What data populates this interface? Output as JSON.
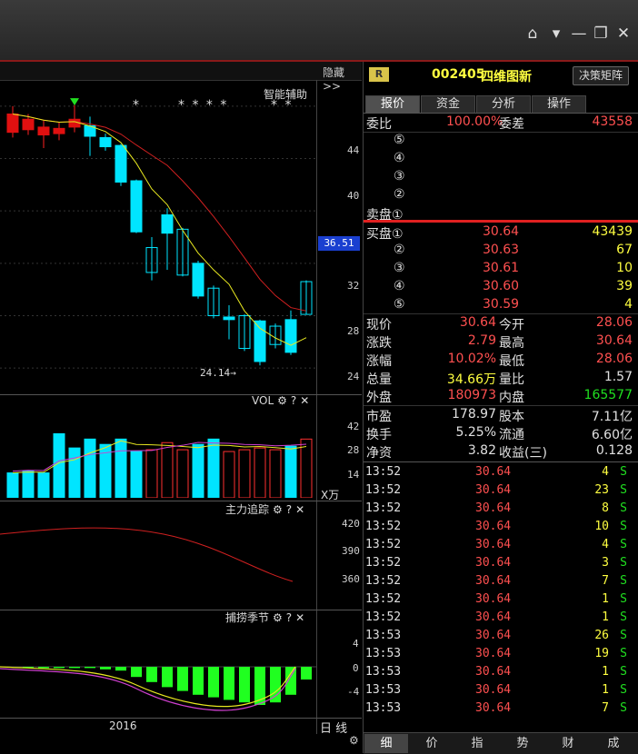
{
  "left": {
    "hide_label": "隐藏>>",
    "assist_label": "智能辅助",
    "stars_a": "*",
    "stars_b": "* * * *",
    "stars_c": "* *",
    "price_axis": [
      "44",
      "40",
      "32",
      "28",
      "24"
    ],
    "current_price_tag": "36.51",
    "low_marker": "24.14",
    "vol_title": "VOL",
    "vol_axis": [
      "42",
      "28",
      "14"
    ],
    "vol_unit": "X万",
    "main_title": "主力追踪",
    "main_axis": [
      "420",
      "390",
      "360"
    ],
    "season_title": "捕捞季节",
    "season_axis": [
      "4",
      "0",
      "-4"
    ],
    "year_label": "2016",
    "period_button": "日 线"
  },
  "quote": {
    "badge": "R",
    "code": "002405",
    "name": "四维图新",
    "matrix_button": "决策矩阵",
    "tabs": [
      "报价",
      "资金",
      "分析",
      "操作"
    ],
    "weibi_label": "委比",
    "weibi_value": "100.00%",
    "weicha_label": "委差",
    "weicha_value": "43558",
    "sell_labels": [
      "⑤",
      "④",
      "③",
      "②",
      "卖盘①"
    ],
    "buy": [
      {
        "label": "买盘①",
        "price": "30.64",
        "vol": "43439"
      },
      {
        "label": "②",
        "price": "30.63",
        "vol": "67"
      },
      {
        "label": "③",
        "price": "30.61",
        "vol": "10"
      },
      {
        "label": "④",
        "price": "30.60",
        "vol": "39"
      },
      {
        "label": "⑤",
        "price": "30.59",
        "vol": "4"
      }
    ],
    "stats1": [
      {
        "l1": "现价",
        "v1": "30.64",
        "l2": "今开",
        "v2": "28.06"
      },
      {
        "l1": "涨跌",
        "v1": "2.79",
        "l2": "最高",
        "v2": "30.64"
      },
      {
        "l1": "涨幅",
        "v1": "10.02%",
        "l2": "最低",
        "v2": "28.06"
      },
      {
        "l1": "总量",
        "v1": "34.66万",
        "l2": "量比",
        "v2": "1.57"
      },
      {
        "l1": "外盘",
        "v1": "180973",
        "l2": "内盘",
        "v2": "165577"
      }
    ],
    "stats2": [
      {
        "l1": "市盈",
        "v1": "178.97",
        "l2": "股本",
        "v2": "7.11亿"
      },
      {
        "l1": "换手",
        "v1": "5.25%",
        "l2": "流通",
        "v2": "6.60亿"
      },
      {
        "l1": "净资",
        "v1": "3.82",
        "l2": "收益(三)",
        "v2": "0.128"
      }
    ],
    "ticks": [
      {
        "t": "13:52",
        "p": "30.64",
        "v": "4",
        "s": "S"
      },
      {
        "t": "13:52",
        "p": "30.64",
        "v": "23",
        "s": "S"
      },
      {
        "t": "13:52",
        "p": "30.64",
        "v": "8",
        "s": "S"
      },
      {
        "t": "13:52",
        "p": "30.64",
        "v": "10",
        "s": "S"
      },
      {
        "t": "13:52",
        "p": "30.64",
        "v": "4",
        "s": "S"
      },
      {
        "t": "13:52",
        "p": "30.64",
        "v": "3",
        "s": "S"
      },
      {
        "t": "13:52",
        "p": "30.64",
        "v": "7",
        "s": "S"
      },
      {
        "t": "13:52",
        "p": "30.64",
        "v": "1",
        "s": "S"
      },
      {
        "t": "13:52",
        "p": "30.64",
        "v": "1",
        "s": "S"
      },
      {
        "t": "13:53",
        "p": "30.64",
        "v": "26",
        "s": "S"
      },
      {
        "t": "13:53",
        "p": "30.64",
        "v": "19",
        "s": "S"
      },
      {
        "t": "13:53",
        "p": "30.64",
        "v": "1",
        "s": "S"
      },
      {
        "t": "13:53",
        "p": "30.64",
        "v": "1",
        "s": "S"
      },
      {
        "t": "13:53",
        "p": "30.64",
        "v": "7",
        "s": "S"
      }
    ],
    "bottom_tabs": [
      "细",
      "价",
      "指",
      "势",
      "财",
      "成"
    ]
  },
  "chart_data": {
    "type": "candlestick",
    "price_axis_range": [
      22,
      46
    ],
    "candles": [
      {
        "o": 24.3,
        "c": 24.3,
        "h": 24.3,
        "l": 24.3,
        "up": true
      },
      {
        "o": 42.0,
        "c": 43.4,
        "h": 44.0,
        "l": 41.6,
        "up": true
      },
      {
        "o": 42.2,
        "c": 43.0,
        "h": 43.4,
        "l": 41.8,
        "up": true
      },
      {
        "o": 41.8,
        "c": 42.4,
        "h": 42.9,
        "l": 40.8,
        "up": true
      },
      {
        "o": 41.9,
        "c": 42.3,
        "h": 42.8,
        "l": 41.4,
        "up": true
      },
      {
        "o": 42.4,
        "c": 43.0,
        "h": 44.6,
        "l": 42.0,
        "up": true
      },
      {
        "o": 42.5,
        "c": 41.7,
        "h": 43.2,
        "l": 40.2,
        "up": false
      },
      {
        "o": 41.6,
        "c": 40.9,
        "h": 41.9,
        "l": 40.6,
        "up": false
      },
      {
        "o": 41.0,
        "c": 38.2,
        "h": 41.1,
        "l": 37.9,
        "up": false
      },
      {
        "o": 38.3,
        "c": 34.4,
        "h": 38.4,
        "l": 34.3,
        "up": false
      },
      {
        "o": 31.3,
        "c": 33.2,
        "h": 34.0,
        "l": 30.7,
        "up": false
      },
      {
        "o": 34.3,
        "c": 35.7,
        "h": 36.2,
        "l": 31.5,
        "up": false
      },
      {
        "o": 34.6,
        "c": 31.1,
        "h": 34.7,
        "l": 31.0,
        "up": false
      },
      {
        "o": 32.0,
        "c": 29.5,
        "h": 32.2,
        "l": 29.3,
        "up": false
      },
      {
        "o": 30.1,
        "c": 28.0,
        "h": 30.3,
        "l": 27.8,
        "up": false
      },
      {
        "o": 27.9,
        "c": 27.7,
        "h": 28.8,
        "l": 26.2,
        "up": false
      },
      {
        "o": 28.0,
        "c": 25.5,
        "h": 28.1,
        "l": 25.3,
        "up": false
      },
      {
        "o": 27.6,
        "c": 24.5,
        "h": 27.7,
        "l": 24.2,
        "up": false
      },
      {
        "o": 27.2,
        "c": 25.8,
        "h": 27.4,
        "l": 25.5,
        "up": false
      },
      {
        "o": 27.7,
        "c": 25.2,
        "h": 28.4,
        "l": 25.0,
        "up": false
      },
      {
        "o": 28.1,
        "c": 30.6,
        "h": 30.7,
        "l": 28.1,
        "up": false
      }
    ],
    "volume": {
      "axis_range": [
        0,
        50
      ],
      "values": [
        0,
        14,
        15,
        14,
        36,
        28,
        33,
        30,
        33,
        26,
        27,
        31,
        27,
        30,
        33,
        26,
        27,
        28,
        27,
        29,
        33
      ],
      "up": [
        false,
        false,
        false,
        false,
        false,
        false,
        false,
        false,
        false,
        false,
        true,
        true,
        true,
        false,
        false,
        true,
        true,
        true,
        true,
        false,
        true
      ]
    }
  }
}
